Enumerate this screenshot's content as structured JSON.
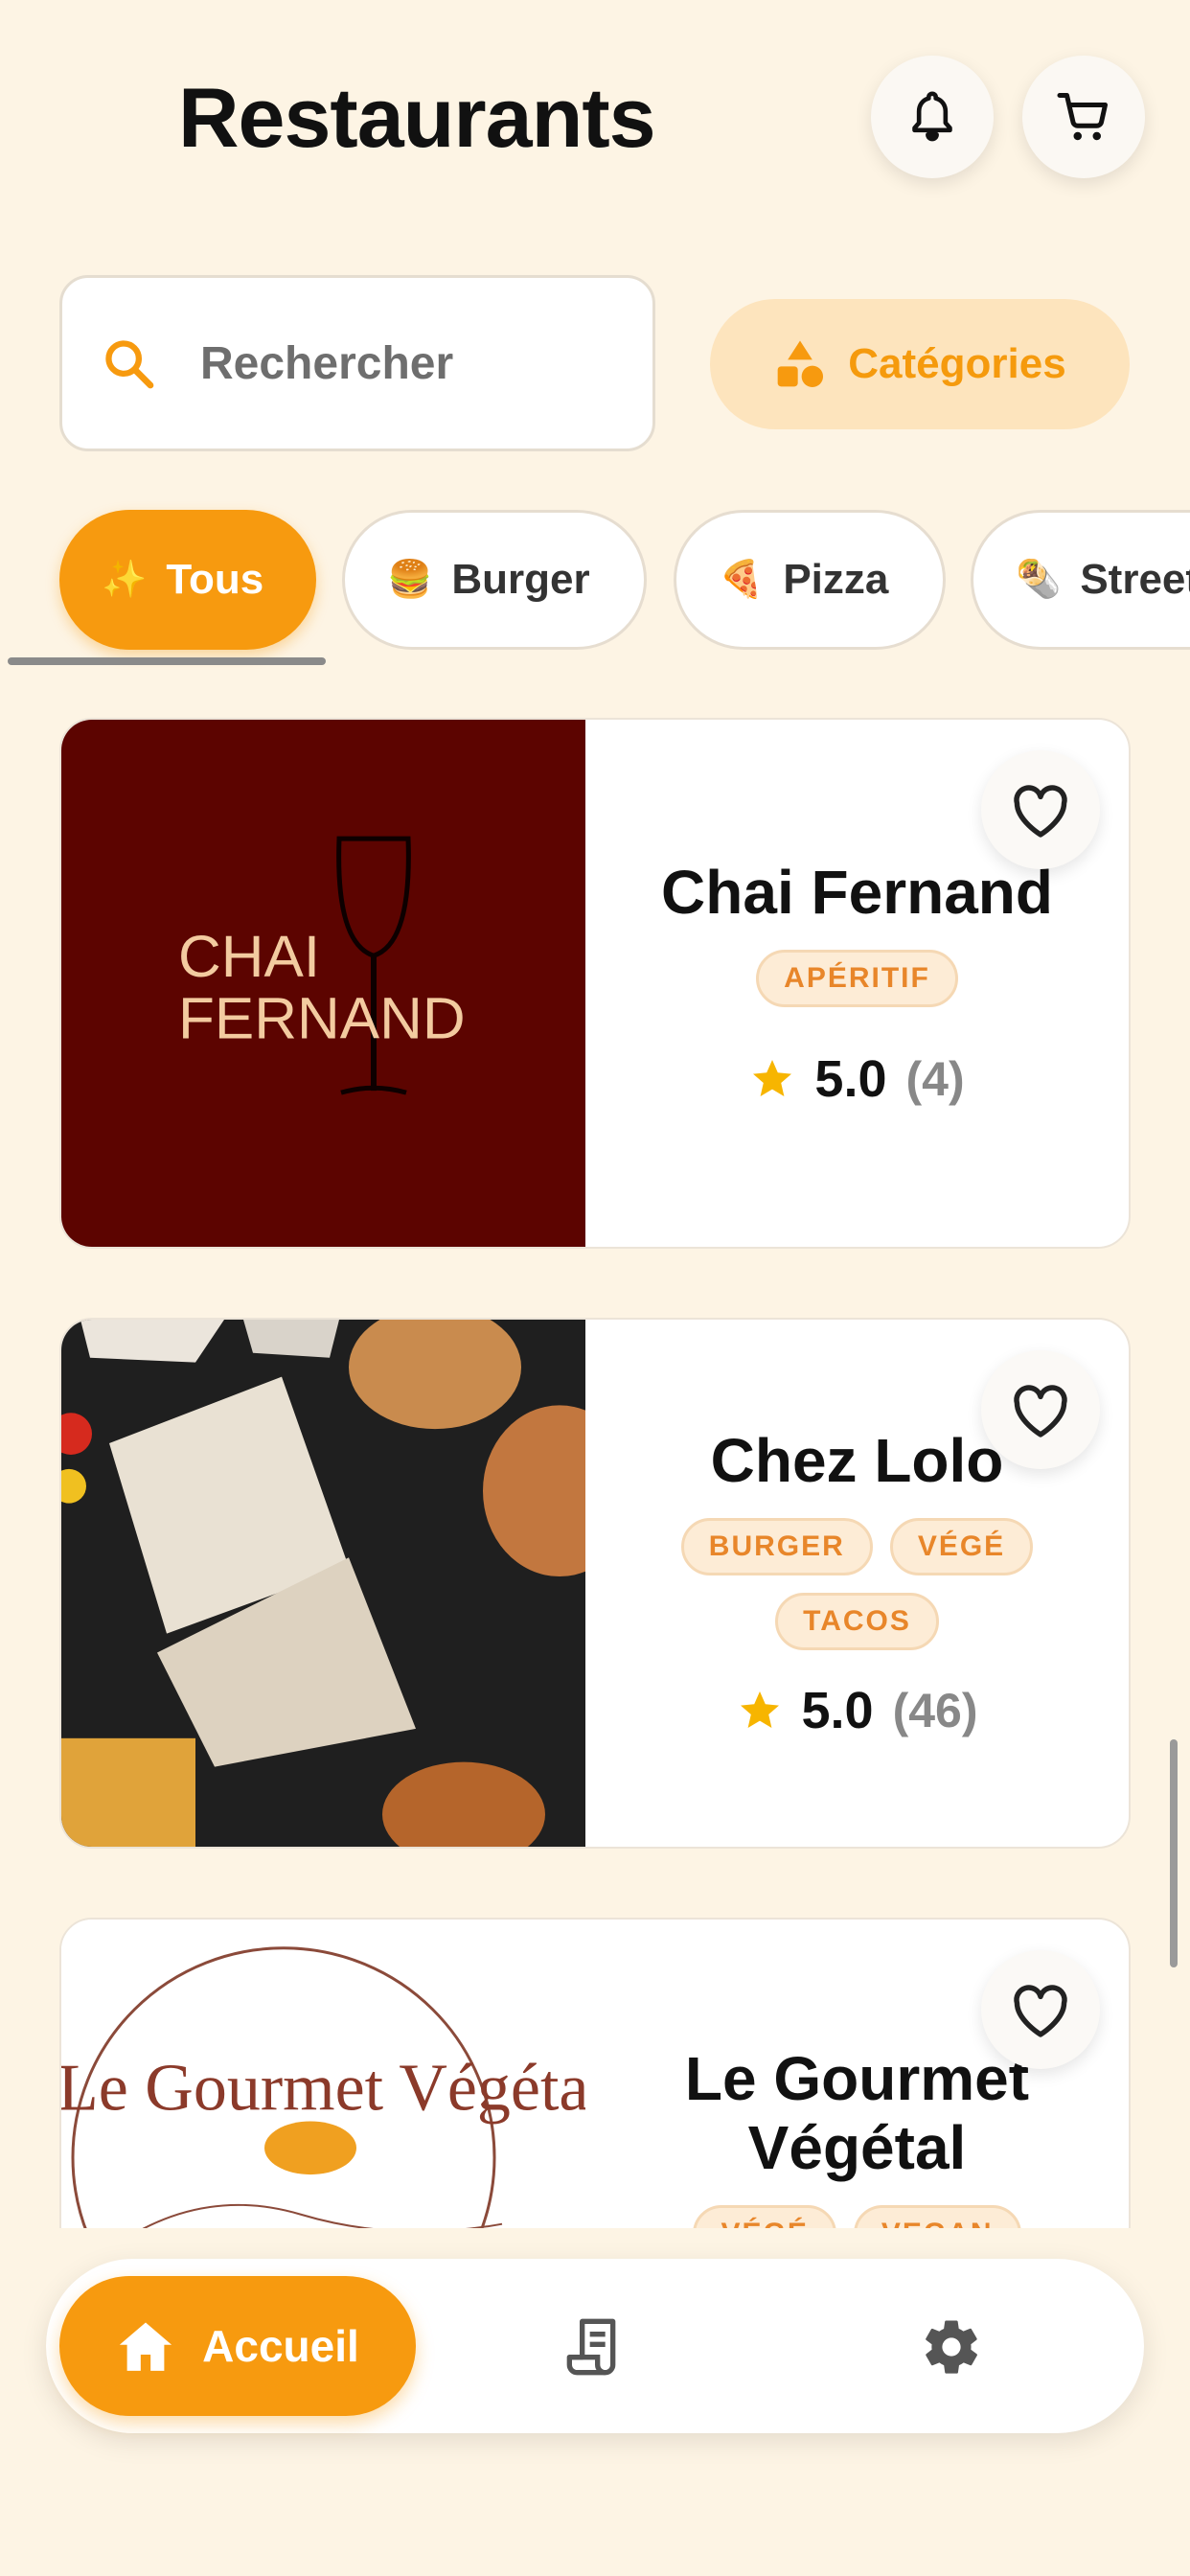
{
  "header": {
    "title": "Restaurants"
  },
  "search": {
    "placeholder": "Rechercher"
  },
  "categories_button": {
    "label": "Catégories"
  },
  "filter_chips": [
    {
      "emoji": "✨",
      "label": "Tous",
      "active": true
    },
    {
      "emoji": "🍔",
      "label": "Burger",
      "active": false
    },
    {
      "emoji": "🍕",
      "label": "Pizza",
      "active": false
    },
    {
      "emoji": "🌯",
      "label": "Street",
      "active": false
    }
  ],
  "restaurants": [
    {
      "name": "Chai Fernand",
      "logo_text": [
        "CHAI",
        "FERNAND"
      ],
      "tags": [
        "APÉRITIF"
      ],
      "rating": "5.0",
      "count": "(4)"
    },
    {
      "name": "Chez Lolo",
      "tags": [
        "BURGER",
        "VÉGÉ",
        "TACOS"
      ],
      "rating": "5.0",
      "count": "(46)"
    },
    {
      "name": "Le Gourmet Végétal",
      "logo_text": "Le Gourmet Végétal",
      "tags": [
        "VÉGÉ",
        "VEGAN"
      ]
    }
  ],
  "bottom_nav": {
    "home_label": "Accueil"
  },
  "colors": {
    "accent": "#f79a0f",
    "background": "#fdf4e4",
    "tag_text": "#e8862a",
    "star": "#f7b500"
  }
}
